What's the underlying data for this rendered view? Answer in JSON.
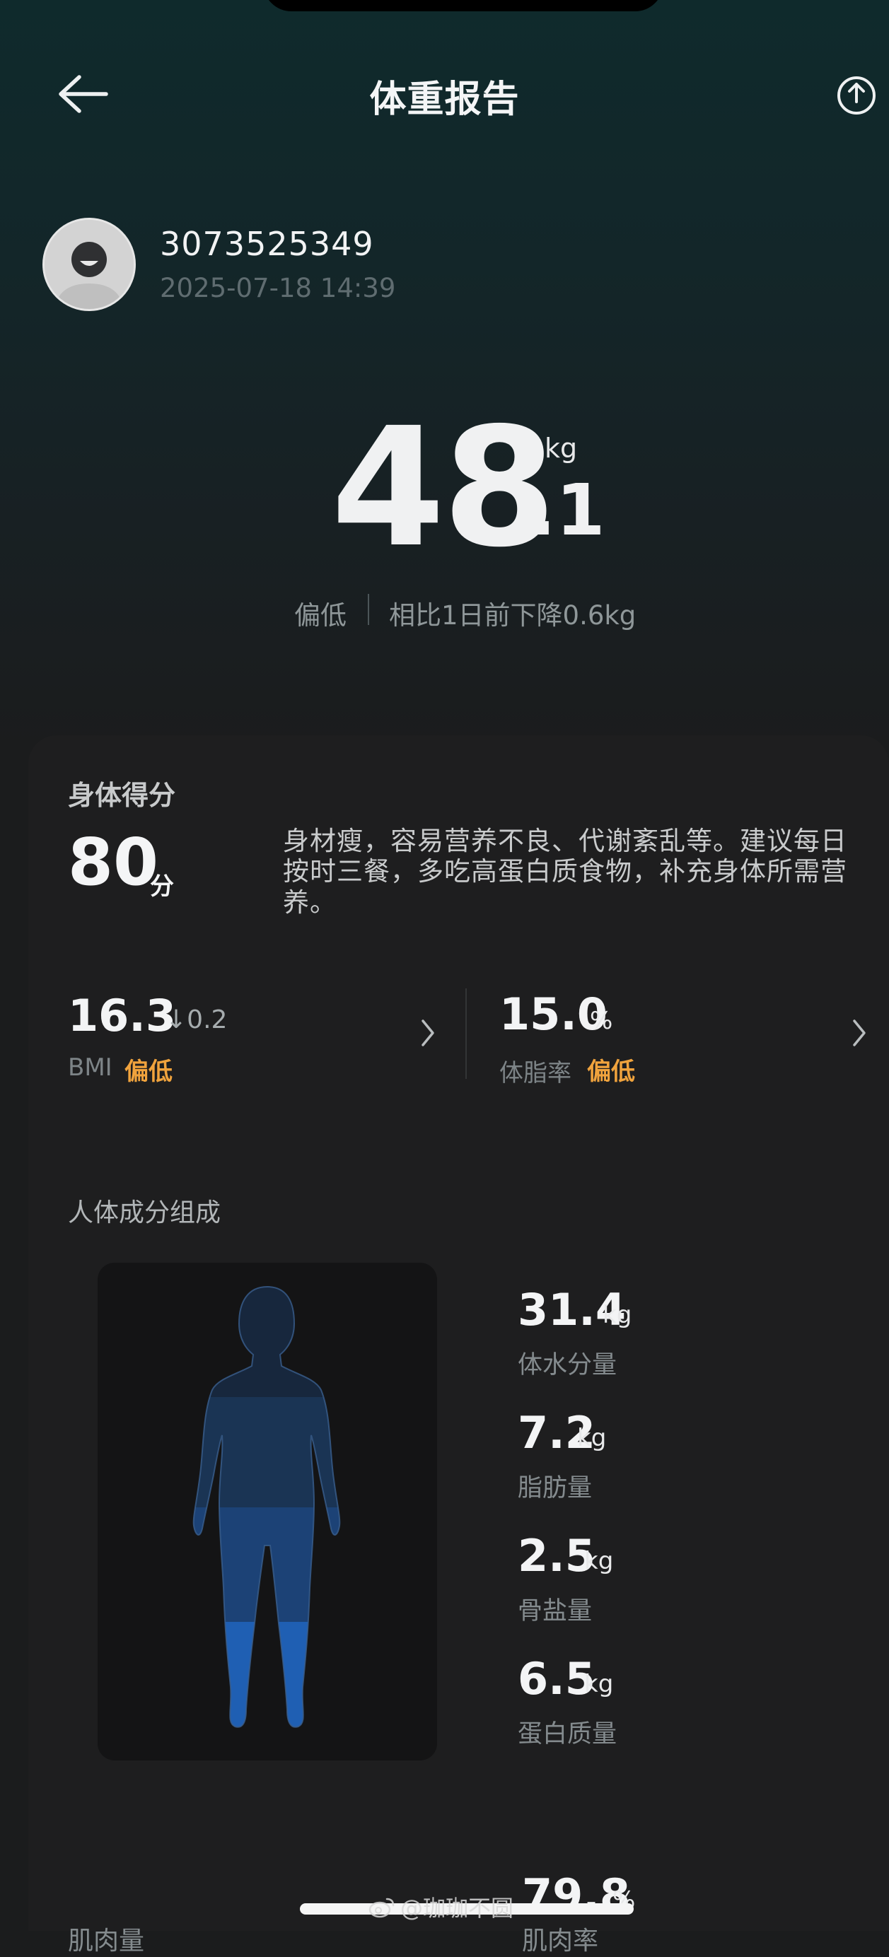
{
  "header": {
    "title": "体重报告",
    "back_icon": "back-arrow-icon",
    "share_icon": "share-icon"
  },
  "user": {
    "id": "3073525349",
    "timestamp": "2025-07-18 14:39"
  },
  "weight": {
    "integer": "48",
    "decimal": ".1",
    "unit": "kg",
    "status": "偏低",
    "comparison": "相比1日前下降0.6kg"
  },
  "score": {
    "title": "身体得分",
    "value": "80",
    "unit": "分",
    "description": "身材瘦，容易营养不良、代谢紊乱等。建议每日按时三餐，多吃高蛋白质食物，补充身体所需营养。"
  },
  "metrics": {
    "bmi": {
      "value": "16.3",
      "delta": "↓0.2",
      "label": "BMI",
      "level": "偏低"
    },
    "body_fat": {
      "value": "15.0",
      "unit": "%",
      "label": "体脂率",
      "level": "偏低"
    }
  },
  "composition": {
    "title": "人体成分组成",
    "items": [
      {
        "value": "31.4",
        "unit": "kg",
        "label": "体水分量"
      },
      {
        "value": "7.2",
        "unit": "kg",
        "label": "脂肪量"
      },
      {
        "value": "2.5",
        "unit": "kg",
        "label": "骨盐量"
      },
      {
        "value": "6.5",
        "unit": "kg",
        "label": "蛋白质量"
      }
    ]
  },
  "bottom": {
    "left_label": "肌肉量",
    "right_value": "79.8",
    "right_unit": "%",
    "right_label": "肌肉率"
  },
  "watermark": {
    "text": "@珈珈不圆"
  },
  "colors": {
    "accent_warning": "#f0a33d",
    "body_highlight": "#1f62b7"
  }
}
